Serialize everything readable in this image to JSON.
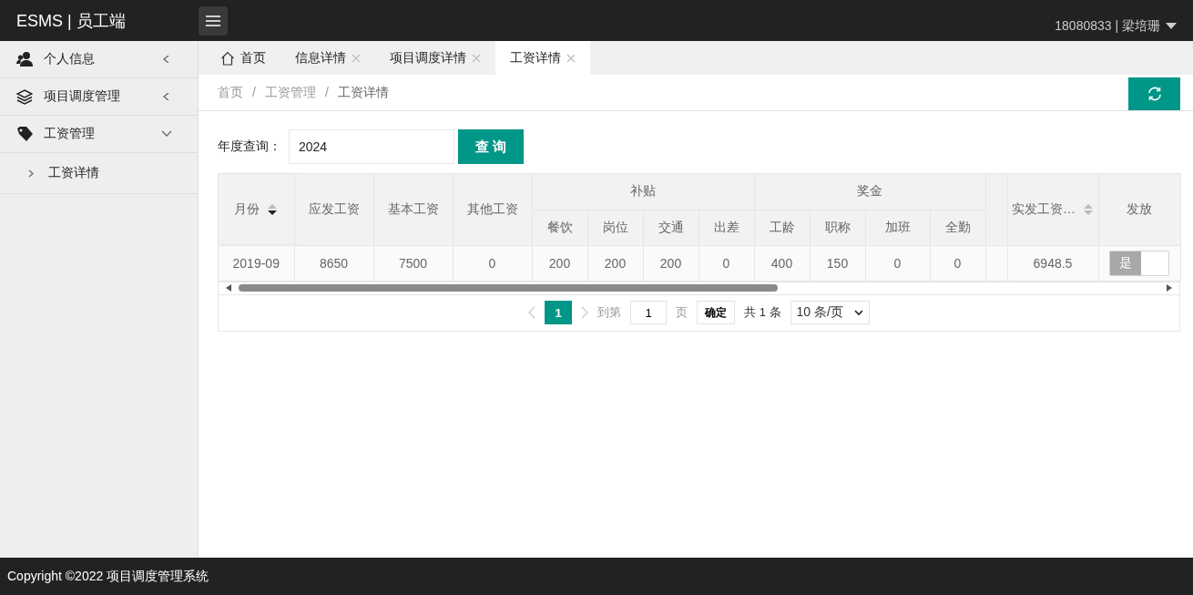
{
  "header": {
    "brand": "ESMS | 员工端",
    "user": "18080833 | 梁培珊"
  },
  "sidebar": {
    "items": [
      {
        "label": "个人信息",
        "kind": "user",
        "expanded": false
      },
      {
        "label": "项目调度管理",
        "kind": "layers",
        "expanded": false
      },
      {
        "label": "工资管理",
        "kind": "tag",
        "expanded": true,
        "children": [
          {
            "label": "工资详情"
          }
        ]
      }
    ]
  },
  "tabs": [
    {
      "label": "首页",
      "kind": "home",
      "selected": false
    },
    {
      "label": "信息详情",
      "kind": "closable",
      "selected": false
    },
    {
      "label": "项目调度详情",
      "kind": "closable",
      "selected": false
    },
    {
      "label": "工资详情",
      "kind": "closable",
      "selected": true
    }
  ],
  "breadcrumb": [
    {
      "label": "首页"
    },
    {
      "separator": "/",
      "label": "工资管理"
    },
    {
      "separator": "/",
      "label": "工资详情"
    }
  ],
  "filter": {
    "label": "年度查询：",
    "value": "2024",
    "button": "查 询"
  },
  "table": {
    "columns": [
      {
        "label": "月份",
        "kind": "text",
        "sorted": true
      },
      {
        "label": "应发工资",
        "kind": "text"
      },
      {
        "label": "基本工资",
        "kind": "text"
      },
      {
        "label": "其他工资",
        "kind": "text"
      },
      {
        "label": "补贴",
        "kind": "group",
        "colspan": 4,
        "children": [
          {
            "label": "餐饮"
          },
          {
            "label": "岗位"
          },
          {
            "label": "交通"
          },
          {
            "label": "出差"
          }
        ]
      },
      {
        "label": "奖金",
        "kind": "group",
        "colspan": 4,
        "children": [
          {
            "label": "工龄"
          },
          {
            "label": "职称"
          },
          {
            "label": "加班"
          },
          {
            "label": "全勤"
          }
        ]
      },
      {
        "label": "实发工资…",
        "kind": "text",
        "sorted": false
      },
      {
        "label": "发放",
        "kind": "switch"
      }
    ],
    "rows": [
      {
        "cells": [
          "2019-09",
          "8650",
          "7500",
          "0",
          "200",
          "200",
          "200",
          "0",
          "400",
          "150",
          "0",
          "0",
          "6948.5"
        ],
        "paid": {
          "text": "是",
          "on": true
        }
      }
    ]
  },
  "pagination": {
    "pages": [
      {
        "label": "1",
        "selected": true
      }
    ],
    "goto_label": "到第",
    "goto_value": "1",
    "page_unit": "页",
    "confirm": "确定",
    "total": "共 1 条",
    "page_size": "10 条/页"
  },
  "footer": {
    "copyright": "Copyright ©2022 项目调度管理系统"
  }
}
